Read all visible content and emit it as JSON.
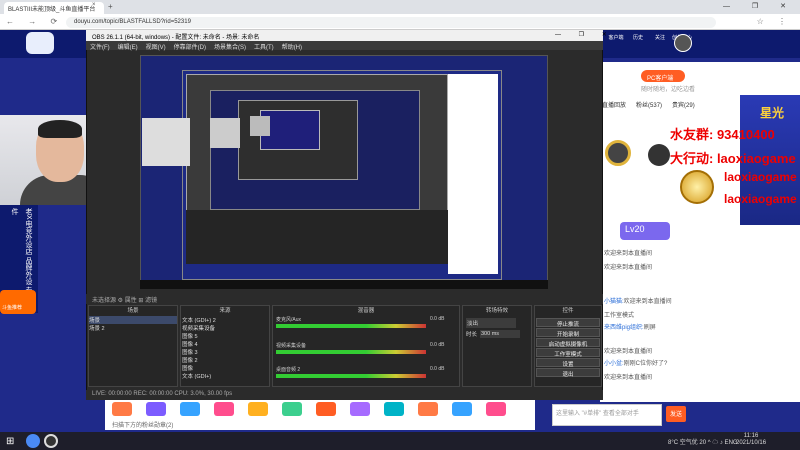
{
  "browser": {
    "tab_title": "BLASTIII未能顶级_斗鱼直播平台",
    "tab_close": "×",
    "new_tab": "+",
    "url": "douyu.com/topic/BLASTFALLSD?rid=52319",
    "nav": "← → ⟳",
    "window_controls": "— ❐ ✕",
    "toolbar_icons": "☆ ⋮"
  },
  "douyu": {
    "header_nav": [
      "客户端",
      "历史",
      "关注",
      "创作中心"
    ],
    "pc_button": "PC客户端",
    "pc_sub": "随时随地，边吃边看",
    "tabs": [
      "直播回放",
      "粉丝(537)",
      "贵宾(29)"
    ],
    "hero_badge": "星光",
    "overlay": [
      "水友群: 93410400",
      "大行动: laoxiaogame",
      "laoxiaogame",
      "laoxiaogame"
    ],
    "level": "Lv20",
    "chat": [
      {
        "text": "欢迎来到本直播间"
      },
      {
        "text": "欢迎来到本直播间"
      },
      {
        "user": "小猫猫:",
        "text": "欢迎来到本直播间"
      },
      {
        "text": "工作室模式"
      },
      {
        "user": "来西维pig组织:",
        "text": "刷屏"
      },
      {
        "text": "欢迎来到本直播间"
      },
      {
        "user": "小小盆:",
        "text": "刚刚C位你好了?"
      },
      {
        "text": "欢迎来到本直播间"
      }
    ],
    "chat_placeholder": "这里输入 \"#单排\" 查看全部对手",
    "send": "发送",
    "left_banner": "老X电竞外设店  品牌外设 专业配件",
    "left_logo": "斗鱼推荐",
    "gift_label": "扫描下方的粉丝勋章(2)",
    "gift_colors": [
      "#ff7a45",
      "#7c5cff",
      "#36a3ff",
      "#ff4d8d",
      "#ffb020",
      "#3ccf8e",
      "#ff5d23",
      "#a66bff",
      "#00b3c7",
      "#ff7a45",
      "#36a3ff",
      "#ff4d8d"
    ]
  },
  "obs": {
    "title": "OBS 26.1.1 (64-bit, windows) - 配置文件: 未命名 - 场景: 未命名",
    "win_controls": "— ❐ ✕",
    "menu": [
      "文件(F)",
      "编辑(E)",
      "视图(V)",
      "停靠部件(D)",
      "场景集合(S)",
      "工具(T)",
      "帮助(H)"
    ],
    "hotkeys": "未选择源   ⚙ 属性  ⊞ 滤镜",
    "docks": {
      "scenes": "场景",
      "sources": "来源",
      "mixer": "混音器",
      "transitions": "转场特效",
      "controls": "控件"
    },
    "scenes": [
      "场景",
      "场景 2"
    ],
    "sources": [
      "文本 (GDI+) 2",
      "视频采集设备",
      "图像 5",
      "图像 4",
      "图像 3",
      "图像 2",
      "图像",
      "文本 (GDI+)"
    ],
    "mixer": [
      {
        "name": "麦克风/Aux",
        "db": "0.0 dB"
      },
      {
        "name": "视频采集设备",
        "db": "0.0 dB"
      },
      {
        "name": "桌面音频 2",
        "db": "0.0 dB"
      }
    ],
    "transition": {
      "type": "淡出",
      "duration_label": "时长",
      "duration": "300 ms"
    },
    "controls": [
      "停止推流",
      "开始录制",
      "启动虚拟摄像机",
      "工作室模式",
      "设置",
      "退出"
    ],
    "status": "LIVE: 00:00:00   REC: 00:00:00   CPU: 3.0%, 30.00 fps"
  },
  "taskbar": {
    "start": "⊞",
    "tray": "8°C 空气优 20  ^ ☁ ♪ ENG",
    "time": "11:16",
    "date": "2021/10/16"
  }
}
